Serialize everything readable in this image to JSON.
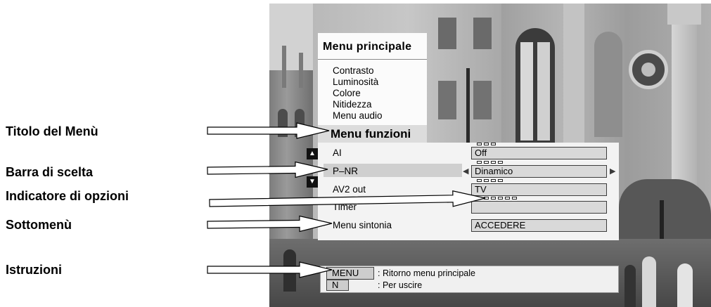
{
  "callouts": [
    {
      "label": "Titolo del Menù"
    },
    {
      "label": "Barra di scelta"
    },
    {
      "label": "Indicatore di opzioni"
    },
    {
      "label": "Sottomenù"
    },
    {
      "label": "Istruzioni"
    }
  ],
  "main_menu": {
    "title": "Menu principale",
    "items": [
      "Contrasto",
      "Luminosità",
      "Colore",
      "Nitidezza",
      "Menu audio"
    ]
  },
  "function_menu": {
    "title": "Menu funzioni",
    "rows": [
      {
        "label": "AI",
        "value": "Off",
        "options": 3
      },
      {
        "label": "P–NR",
        "value": "Dinamico",
        "options": 4,
        "selected": true
      },
      {
        "label": "AV2 out",
        "value": "TV",
        "options": 4
      },
      {
        "label": "Timer",
        "options": 6
      },
      {
        "label": "Menu sintonia",
        "value": "ACCEDERE"
      }
    ]
  },
  "instructions": [
    {
      "key": "MENU",
      "text": ": Ritorno menu principale"
    },
    {
      "key": "N",
      "text": ": Per uscire"
    }
  ],
  "icons": {
    "scroll_up": "up-triangle-icon",
    "scroll_down": "down-triangle-icon",
    "previous_option": "left-triangle-icon",
    "next_option": "right-triangle-icon"
  },
  "colors": {
    "panel": "#f3f3f3",
    "selection_bar": "#cfcfcf",
    "value_box": "#d9d9d9",
    "title_tab": "#dcdcdc"
  }
}
